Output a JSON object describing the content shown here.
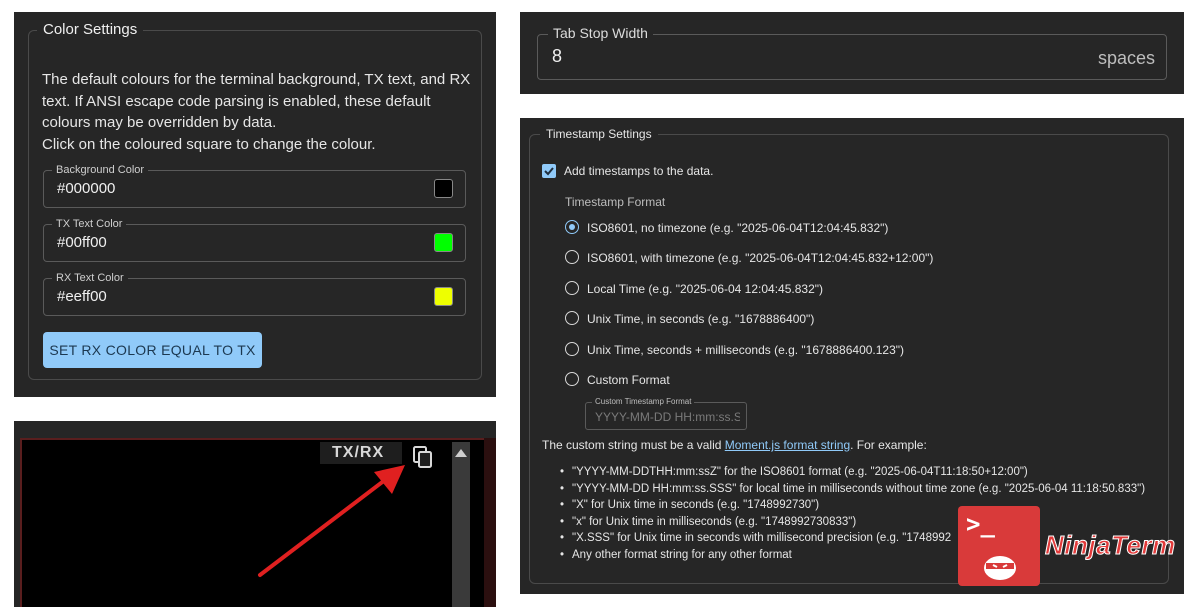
{
  "color_settings": {
    "title": "Color Settings",
    "description": [
      "The default colours for the terminal background, TX text, and RX",
      "text. If ANSI escape code parsing is enabled, these default",
      "colours may be overridden by data.",
      "Click on the coloured square to change the colour."
    ],
    "fields": [
      {
        "label": "Background Color",
        "value": "#000000",
        "swatch": "#000000"
      },
      {
        "label": "TX Text Color",
        "value": "#00ff00",
        "swatch": "#00ff00"
      },
      {
        "label": "RX Text Color",
        "value": "#eeff00",
        "swatch": "#eeff00"
      }
    ],
    "button": "SET RX COLOR EQUAL TO TX"
  },
  "terminal": {
    "label": "TX/RX",
    "copy_icon": "copy-icon",
    "arrow_color": "#e02020"
  },
  "tab_stop": {
    "label": "Tab Stop Width",
    "value": "8",
    "suffix": "spaces"
  },
  "timestamp": {
    "title": "Timestamp Settings",
    "checkbox_label": "Add timestamps to the data.",
    "checkbox_checked": true,
    "format_heading": "Timestamp Format",
    "options": [
      {
        "label": "ISO8601, no timezone (e.g. \"2025-06-04T12:04:45.832\")",
        "selected": true
      },
      {
        "label": "ISO8601, with timezone (e.g. \"2025-06-04T12:04:45.832+12:00\")",
        "selected": false
      },
      {
        "label": "Local Time (e.g. \"2025-06-04 12:04:45.832\")",
        "selected": false
      },
      {
        "label": "Unix Time, in seconds (e.g. \"1678886400\")",
        "selected": false
      },
      {
        "label": "Unix Time, seconds + milliseconds (e.g. \"1678886400.123\")",
        "selected": false
      },
      {
        "label": "Custom Format",
        "selected": false
      }
    ],
    "custom_field_label": "Custom Timestamp Format",
    "custom_field_placeholder": "YYYY-MM-DD HH:mm:ss.SSS",
    "custom_desc_prefix": "The custom string must be a valid ",
    "custom_desc_link": "Moment.js format string",
    "custom_desc_suffix": ". For example:",
    "examples": [
      "\"YYYY-MM-DDTHH:mm:ssZ\" for the ISO8601 format (e.g. \"2025-06-04T11:18:50+12:00\")",
      "\"YYYY-MM-DD HH:mm:ss.SSS\" for local time in milliseconds without time zone (e.g. \"2025-06-04 11:18:50.833\")",
      "\"X\" for Unix time in seconds (e.g. \"1748992730\")",
      "\"x\" for Unix time in milliseconds (e.g. \"1748992730833\")",
      "\"X.SSS\" for Unix time in seconds with millisecond precision (e.g. \"1748992",
      "Any other format string for any other format"
    ]
  },
  "logo": {
    "prompt": ">_",
    "text": "NinjaTerm",
    "color": "#d93a3a"
  }
}
